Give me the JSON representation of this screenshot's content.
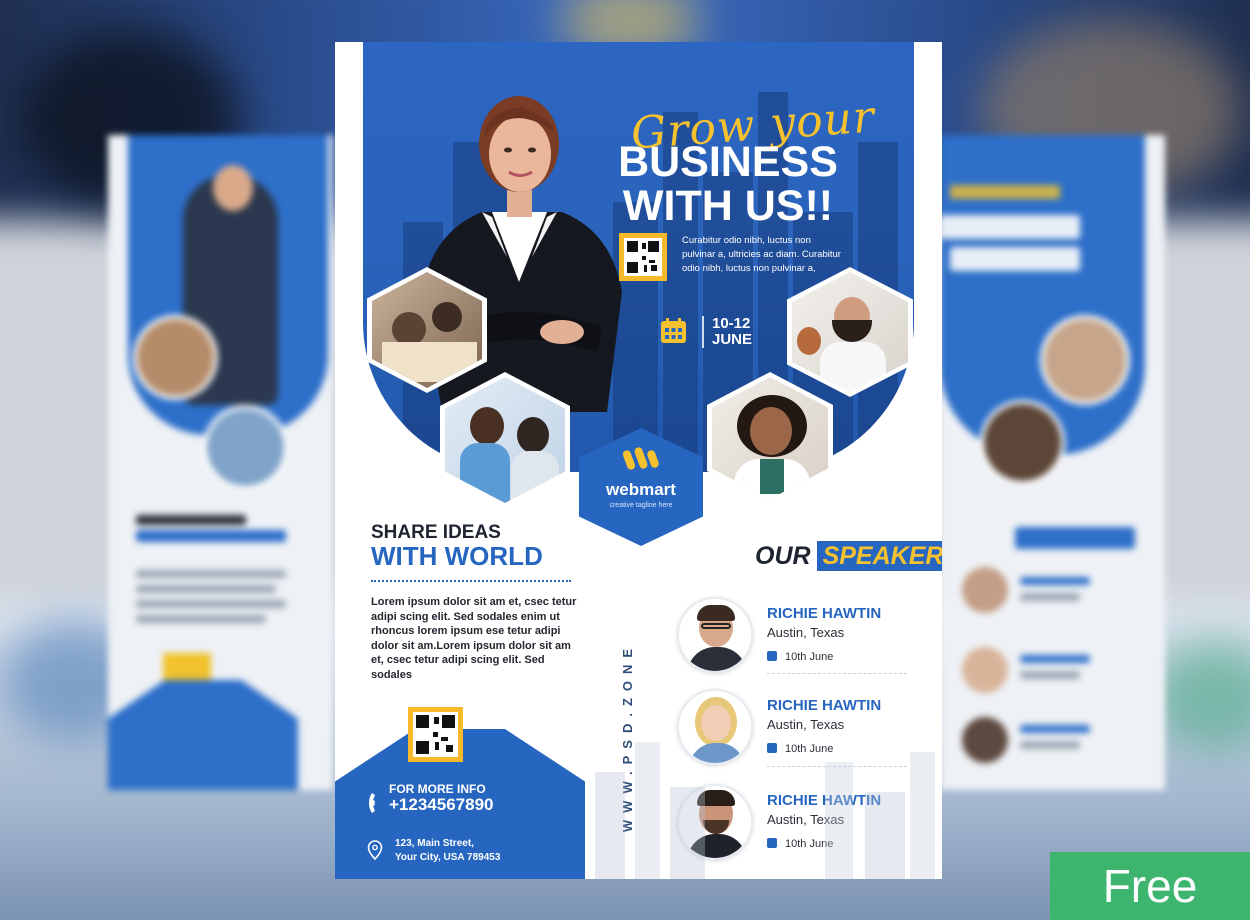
{
  "flyer": {
    "script_title": "Grow your",
    "headline_1": "BUSINESS",
    "headline_2": "WITH US!!",
    "blurb": "Curabitur odio nibh, luctus non pulvinar a, ultricies ac diam. Curabitur odio nibh, luctus non pulvinar a,",
    "date_days": "10-12",
    "date_month": "JUNE",
    "logo_name": "webmart",
    "logo_tagline": "creative tagline here",
    "share_line1": "SHARE IDEAS",
    "share_line2": "WITH WORLD",
    "lorem": "Lorem ipsum dolor sit am et, csec tetur adipi scing elit. Sed sodales enim ut rhoncus lorem ipsum ese tetur adipi dolor sit am.Lorem ipsum dolor sit am et, csec tetur adipi scing elit. Sed sodales",
    "speakers_label_our": "OUR",
    "speakers_label_speakers": "SPEAKERS",
    "vertical_url": "WWW.PSD.ZONE",
    "speakers": [
      {
        "name": "RICHIE HAWTIN",
        "city": "Austin, Texas",
        "date": "10th June"
      },
      {
        "name": "RICHIE HAWTIN",
        "city": "Austin, Texas",
        "date": "10th June"
      },
      {
        "name": "RICHIE HAWTIN",
        "city": "Austin, Texas",
        "date": "10th June"
      }
    ],
    "more_info_label": "FOR MORE INFO",
    "phone": "+1234567890",
    "address_line1": "123, Main Street,",
    "address_line2": "Your City, USA 789453"
  },
  "badge": {
    "label": "Free",
    "color": "#3eb56f"
  },
  "colors": {
    "primary_blue": "#2766c0",
    "accent_yellow": "#f5c12e",
    "dark_text": "#1e2430"
  },
  "icons": [
    "calendar-icon",
    "phone-icon",
    "location-pin-icon",
    "qr-code-icon",
    "webmart-logo-icon"
  ]
}
